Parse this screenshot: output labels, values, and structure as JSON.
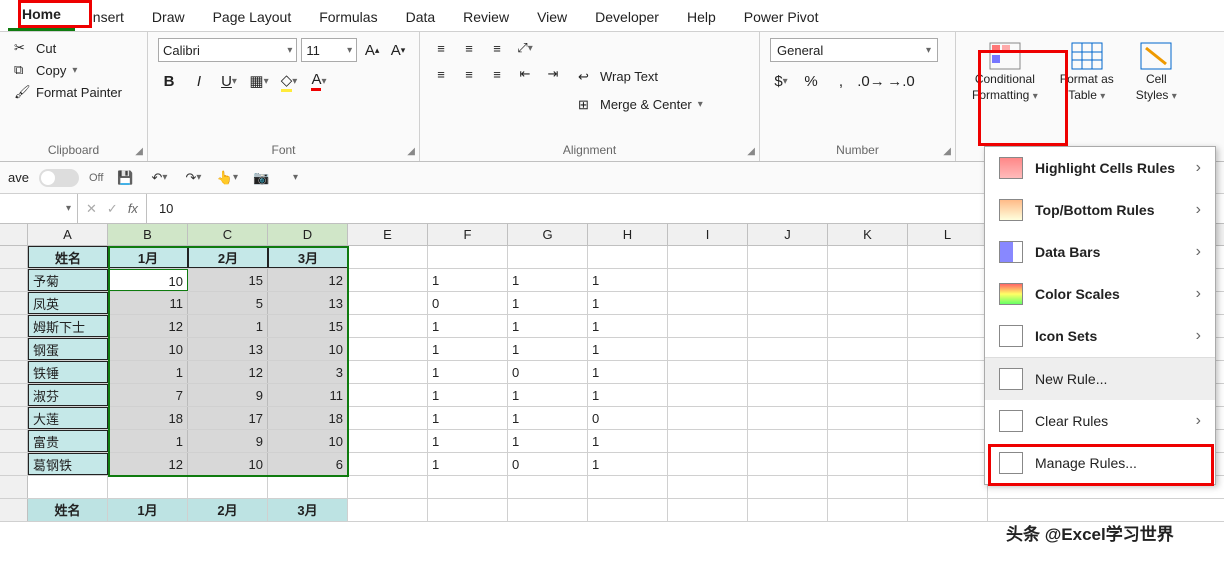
{
  "tabs": [
    "Home",
    "Insert",
    "Draw",
    "Page Layout",
    "Formulas",
    "Data",
    "Review",
    "View",
    "Developer",
    "Help",
    "Power Pivot"
  ],
  "clipboard": {
    "cut": "Cut",
    "copy": "Copy",
    "painter": "Format Painter",
    "label": "Clipboard"
  },
  "font": {
    "name": "Calibri",
    "size": "11",
    "label": "Font"
  },
  "alignment": {
    "wrap": "Wrap Text",
    "merge": "Merge & Center",
    "label": "Alignment"
  },
  "number": {
    "format": "General",
    "label": "Number"
  },
  "styles": {
    "cf": "Conditional",
    "cf2": "Formatting",
    "fat": "Format as",
    "fat2": "Table",
    "cs": "Cell",
    "cs2": "Styles"
  },
  "autosave": {
    "label": "ave",
    "off": "Off"
  },
  "namebox": "",
  "formula": "10",
  "cols": [
    "A",
    "B",
    "C",
    "D",
    "E",
    "F",
    "G",
    "H",
    "I",
    "J",
    "K",
    "L"
  ],
  "headers": {
    "name": "姓名",
    "m1": "1月",
    "m2": "2月",
    "m3": "3月"
  },
  "rows": [
    {
      "name": "予菊",
      "b": "10",
      "c": "15",
      "d": "12",
      "f": "1",
      "g": "1",
      "h": "1"
    },
    {
      "name": "凤英",
      "b": "11",
      "c": "5",
      "d": "13",
      "f": "0",
      "g": "1",
      "h": "1"
    },
    {
      "name": "姆斯下士",
      "b": "12",
      "c": "1",
      "d": "15",
      "f": "1",
      "g": "1",
      "h": "1"
    },
    {
      "name": "钢蛋",
      "b": "10",
      "c": "13",
      "d": "10",
      "f": "1",
      "g": "1",
      "h": "1"
    },
    {
      "name": "铁锤",
      "b": "1",
      "c": "12",
      "d": "3",
      "f": "1",
      "g": "0",
      "h": "1"
    },
    {
      "name": "淑芬",
      "b": "7",
      "c": "9",
      "d": "11",
      "f": "1",
      "g": "1",
      "h": "1"
    },
    {
      "name": "大莲",
      "b": "18",
      "c": "17",
      "d": "18",
      "f": "1",
      "g": "1",
      "h": "0"
    },
    {
      "name": "富贵",
      "b": "1",
      "c": "9",
      "d": "10",
      "f": "1",
      "g": "1",
      "h": "1"
    },
    {
      "name": "葛钢铁",
      "b": "12",
      "c": "10",
      "d": "6",
      "f": "1",
      "g": "0",
      "h": "1"
    }
  ],
  "headers2": {
    "name": "姓名",
    "m1": "1月",
    "m2": "2月",
    "m3": "3月"
  },
  "cf_menu": {
    "hlr": "Highlight Cells Rules",
    "tb": "Top/Bottom Rules",
    "db": "Data Bars",
    "cs": "Color Scales",
    "is": "Icon Sets",
    "nr": "New Rule...",
    "cr": "Clear Rules",
    "mr": "Manage Rules..."
  },
  "watermark": "头条 @Excel学习世界"
}
